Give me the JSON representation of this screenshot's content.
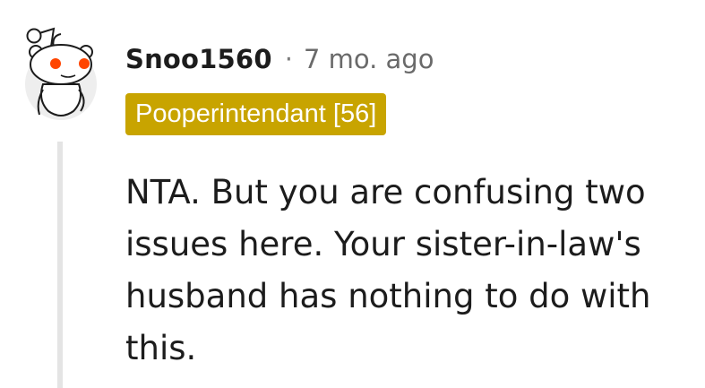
{
  "comment": {
    "author": "Snoo1560",
    "separator": "·",
    "timestamp": "7 mo. ago",
    "flair": "Pooperintendant [56]",
    "body": "NTA. But you are confusing two issues here. Your sister-in-law's husband has nothing to do with this.",
    "avatar_icon": "snoo-avatar-icon"
  },
  "colors": {
    "flair_background": "#c8a400",
    "flair_text": "#ffffff",
    "snoo_eyes": "#ff4500",
    "thread_line": "#e4e4e4",
    "text": "#1c1c1c",
    "muted": "#6a6a6a"
  }
}
